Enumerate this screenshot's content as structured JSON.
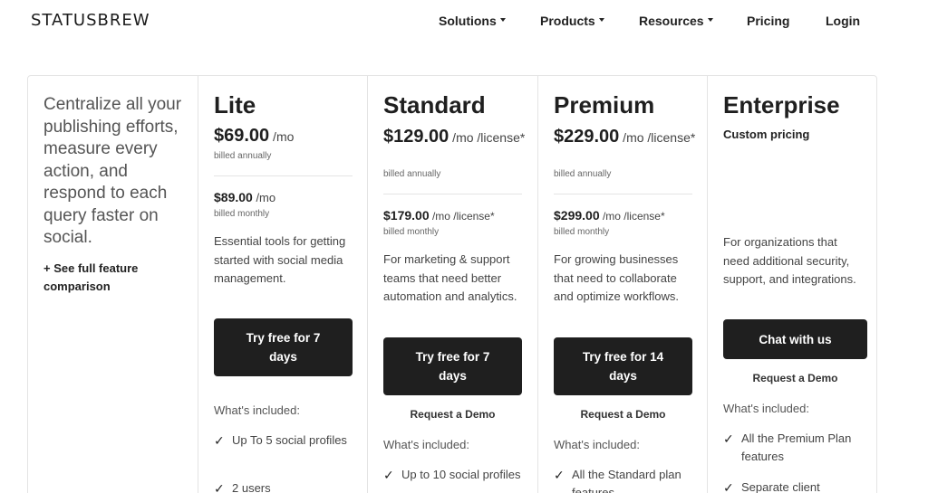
{
  "header": {
    "logo": "STATUSBREW",
    "nav": [
      {
        "label": "Solutions",
        "dropdown": true
      },
      {
        "label": "Products",
        "dropdown": true
      },
      {
        "label": "Resources",
        "dropdown": true
      },
      {
        "label": "Pricing",
        "dropdown": false
      },
      {
        "label": "Login",
        "dropdown": false
      }
    ]
  },
  "intro": {
    "text": "Centralize all your publishing efforts, measure every action, and respond to each query faster on social.",
    "link": "+ See full feature comparison"
  },
  "plans": {
    "lite": {
      "name": "Lite",
      "price": "$69.00",
      "price_unit": " /mo",
      "billed": "billed annually",
      "monthly_price": "$89.00",
      "monthly_unit": " /mo",
      "monthly_billed": "billed monthly",
      "desc": "Essential tools for getting started with social media management.",
      "cta": "Try free for 7 days",
      "included": "What's included:",
      "features": [
        "Up To 5 social profiles",
        "2 users"
      ]
    },
    "standard": {
      "name": "Standard",
      "price": "$129.00",
      "price_unit": " /mo /license*",
      "billed": "billed annually",
      "monthly_price": "$179.00",
      "monthly_unit": " /mo /license*",
      "monthly_billed": "billed monthly",
      "desc": "For marketing & support teams that need better automation and analytics.",
      "cta": "Try free for 7 days",
      "demo": "Request a Demo",
      "included": "What's included:",
      "features": [
        "Up to 10 social profiles"
      ]
    },
    "premium": {
      "name": "Premium",
      "price": "$229.00",
      "price_unit": " /mo /license*",
      "billed": "billed annually",
      "monthly_price": "$299.00",
      "monthly_unit": " /mo /license*",
      "monthly_billed": "billed monthly",
      "desc": "For growing businesses that need to collaborate and optimize workflows.",
      "cta": "Try free for 14 days",
      "demo": "Request a Demo",
      "included": "What's included:",
      "features": [
        "All the Standard plan features"
      ]
    },
    "enterprise": {
      "name": "Enterprise",
      "custom": "Custom pricing",
      "desc": "For organizations that need additional security, support, and integrations.",
      "cta": "Chat with us",
      "demo": "Request a Demo",
      "included": "What's included:",
      "features": [
        "All the Premium Plan features",
        "Separate client"
      ]
    }
  },
  "icons": {
    "check": "check-icon",
    "caret": "chevron-down-icon"
  }
}
